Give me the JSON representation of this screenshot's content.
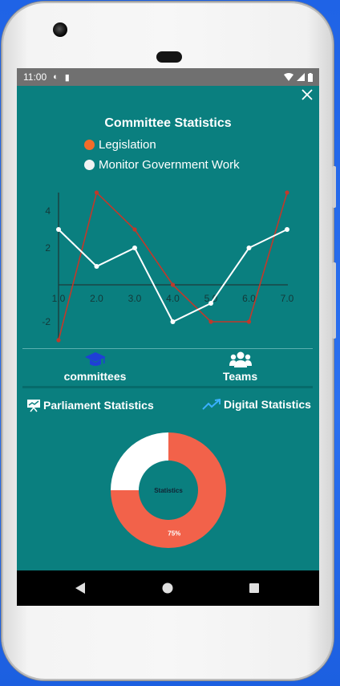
{
  "status": {
    "time": "11:00"
  },
  "chart": {
    "title": "Committee Statistics",
    "legend": [
      {
        "name": "Legislation",
        "color": "#f26c2a"
      },
      {
        "name": "Monitor Government Work",
        "color": "#ffffff"
      }
    ]
  },
  "chart_data": {
    "type": "line",
    "x": [
      1.0,
      2.0,
      3.0,
      4.0,
      5.0,
      6.0,
      7.0
    ],
    "x_tick_labels": [
      "1.0",
      "2.0",
      "3.0",
      "4.0",
      "5.0",
      "6.0",
      "7.0"
    ],
    "y_tick_labels": [
      "4",
      "2",
      "-2"
    ],
    "y_ticks": [
      4,
      2,
      -2
    ],
    "ylim": [
      -3,
      5
    ],
    "series": [
      {
        "name": "Legislation",
        "color": "#c0392b",
        "values": [
          -3,
          5,
          3,
          0,
          -2,
          -2,
          5
        ]
      },
      {
        "name": "Monitor Government Work",
        "color": "#ffffff",
        "values": [
          3,
          1,
          2,
          -2,
          -1,
          2,
          3
        ]
      }
    ],
    "donut": {
      "center_label": "Statistics",
      "slices": [
        {
          "value": 75,
          "label": "75%",
          "color": "#f2624a"
        },
        {
          "value": 25,
          "label": "",
          "color": "#ffffff"
        }
      ]
    }
  },
  "tabs": [
    {
      "label": "committees",
      "icon": "graduation-cap-icon",
      "color": "#1f3fd6"
    },
    {
      "label": "Teams",
      "icon": "group-icon",
      "color": "#ffffff"
    }
  ],
  "stats_links": {
    "parliament": "Parliament Statistics",
    "digital": "Digital Statistics"
  }
}
